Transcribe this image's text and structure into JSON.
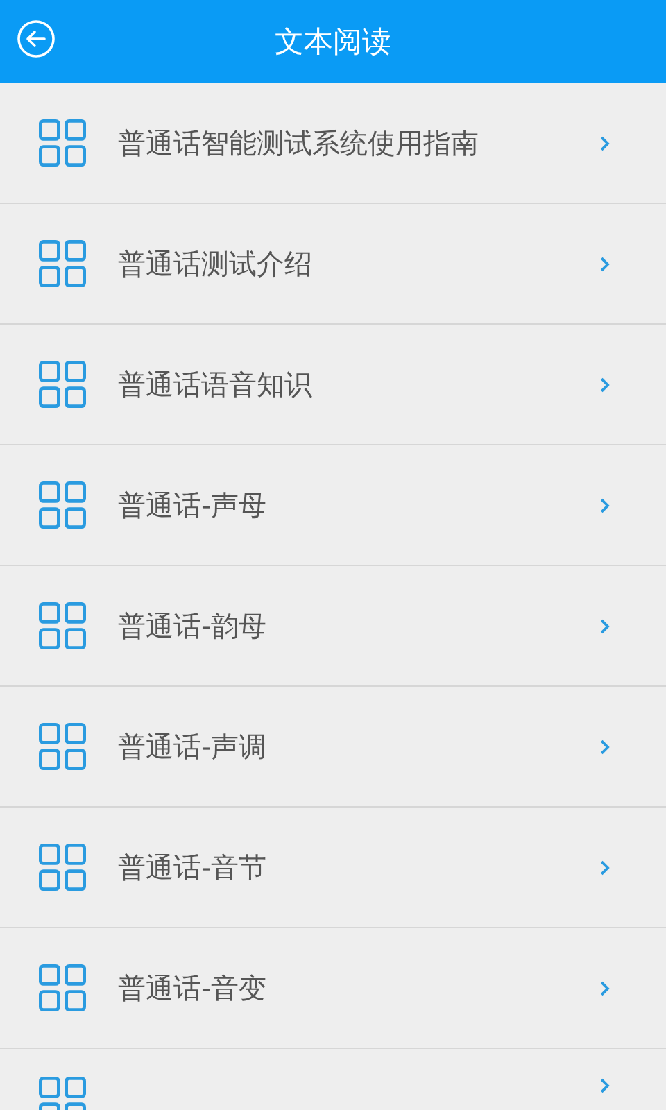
{
  "header": {
    "title": "文本阅读"
  },
  "items": [
    {
      "label": "普通话智能测试系统使用指南"
    },
    {
      "label": "普通话测试介绍"
    },
    {
      "label": "普通话语音知识"
    },
    {
      "label": "普通话-声母"
    },
    {
      "label": "普通话-韵母"
    },
    {
      "label": "普通话-声调"
    },
    {
      "label": "普通话-音节"
    },
    {
      "label": "普通话-音变"
    },
    {
      "kind": "cut"
    }
  ]
}
